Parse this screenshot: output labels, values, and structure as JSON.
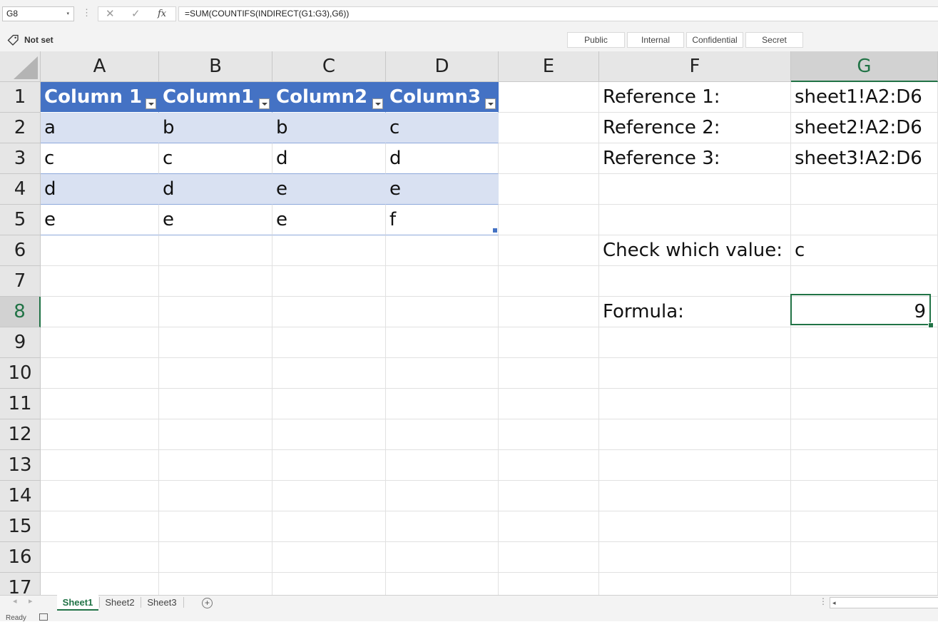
{
  "formula_bar": {
    "name_box": "G8",
    "cancel_icon": "✕",
    "enter_icon": "✓",
    "fx_label": "fx",
    "formula": "=SUM(COUNTIFS(INDIRECT(G1:G3),G6))"
  },
  "sensitivity": {
    "label": "Not set",
    "buttons": [
      "Public",
      "Internal",
      "Confidential",
      "Secret"
    ]
  },
  "columns": [
    "A",
    "B",
    "C",
    "D",
    "E",
    "F",
    "G"
  ],
  "selected_column": "G",
  "rows": [
    "1",
    "2",
    "3",
    "4",
    "5",
    "6",
    "7",
    "8",
    "9",
    "10",
    "11",
    "12",
    "13",
    "14",
    "15",
    "16",
    "17"
  ],
  "selected_row": "8",
  "table": {
    "headers": [
      "Column 1",
      "Column1",
      "Column2",
      "Column3"
    ],
    "rows": [
      [
        "a",
        "b",
        "b",
        "c"
      ],
      [
        "c",
        "c",
        "d",
        "d"
      ],
      [
        "d",
        "d",
        "e",
        "e"
      ],
      [
        "e",
        "e",
        "e",
        "f"
      ]
    ]
  },
  "side": {
    "ref1_label": "Reference 1:",
    "ref1_value": "sheet1!A2:D6",
    "ref2_label": "Reference 2:",
    "ref2_value": "sheet2!A2:D6",
    "ref3_label": "Reference 3:",
    "ref3_value": "sheet3!A2:D6",
    "check_label": "Check which value:",
    "check_value": "c",
    "formula_label": "Formula:",
    "formula_value": "9"
  },
  "sheets": [
    "Sheet1",
    "Sheet2",
    "Sheet3"
  ],
  "active_sheet": "Sheet1",
  "status": "Ready",
  "colors": {
    "table_header": "#4472c4",
    "table_band": "#d9e1f2",
    "excel_green": "#217346"
  }
}
